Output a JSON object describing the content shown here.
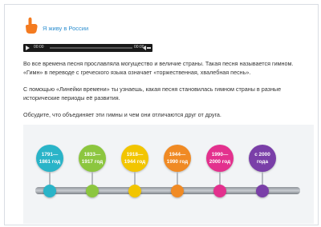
{
  "section": {
    "title": "Я живу в России",
    "icon": "pointing-hand-icon"
  },
  "player": {
    "current_time": "00:00",
    "duration": "00:00"
  },
  "paragraphs": [
    "Во все времена песня прославляла могущество и величие страны. Такая песня называется гимном. «Гимн» в переводе с греческого языка означает «торжественная, хвалебная песнь».",
    "С помощью «Линейки времени» ты узнаешь, какая песня становилась гимном страны в разные исторические периоды её развития.",
    "Обсудите, что объединяет эти гимны и чем они отличаются друг от друга."
  ],
  "timeline": [
    {
      "label": "1791—\n1861 год",
      "color": "#2ab4c8"
    },
    {
      "label": "1833—\n1917 год",
      "color": "#8cc63f"
    },
    {
      "label": "1918—\n1944 год",
      "color": "#f2c500"
    },
    {
      "label": "1944—\n1990 год",
      "color": "#f08a24"
    },
    {
      "label": "1990—\n2000 год",
      "color": "#e3318e"
    },
    {
      "label": "с 2000\nгода",
      "color": "#7a3fa8"
    }
  ]
}
